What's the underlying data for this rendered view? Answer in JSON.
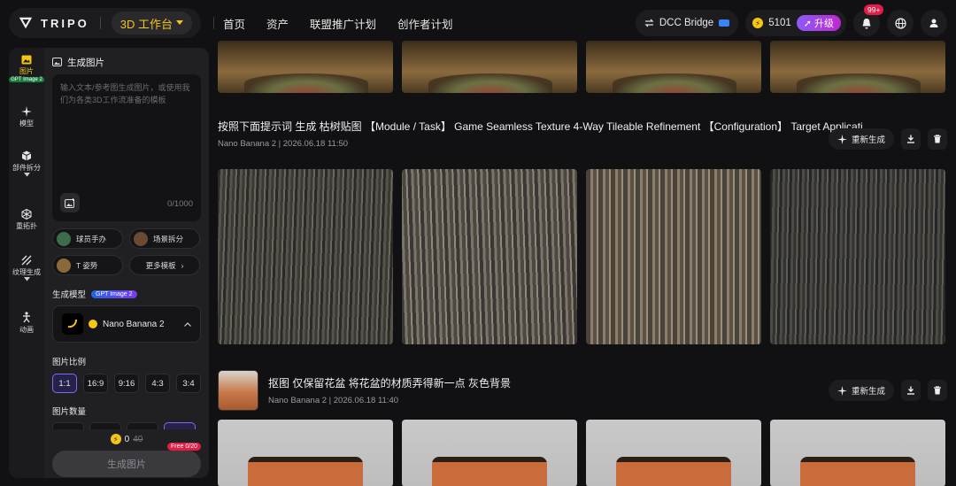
{
  "brand": {
    "name": "TRIPO",
    "workspace_label": "3D 工作台"
  },
  "nav": [
    "首页",
    "资产",
    "联盟推广计划",
    "创作者计划"
  ],
  "topright": {
    "dcc_label": "DCC Bridge",
    "credits": "5101",
    "upgrade_label": "升级",
    "notif_count": "99+"
  },
  "rail": [
    {
      "label": "图片",
      "tag": "GPT Image 2",
      "icon": "image-icon"
    },
    {
      "label": "模型",
      "icon": "sparkle-icon"
    },
    {
      "label": "部件拆分",
      "icon": "cube-icon"
    },
    {
      "label": "重拓扑",
      "icon": "topology-icon"
    },
    {
      "label": "纹理生成",
      "icon": "texture-icon"
    },
    {
      "label": "动画",
      "icon": "figure-icon"
    }
  ],
  "panel": {
    "title": "生成图片",
    "prompt_placeholder": "输入文本/参考图生成图片，或使用我们为各类3D工作流准备的模板",
    "prompt_count": "0/1000",
    "templates": [
      "球员手办",
      "场景拆分",
      "T 姿势"
    ],
    "more_templates": "更多模板",
    "model_label": "生成模型",
    "model_tag": "GPT Image 2",
    "model_name": "Nano Banana 2",
    "ratio_label": "图片比例",
    "ratios": [
      "1:1",
      "16:9",
      "9:16",
      "4:3",
      "3:4"
    ],
    "qty_label": "图片数量",
    "cost": "0",
    "cost_old": "40",
    "free_tag": "Free 0/20",
    "generate_label": "生成图片"
  },
  "generations": [
    {
      "title": "按照下面提示词 生成 枯树贴图 【Module / Task】 Game Seamless Texture 4-Way Tileable Refinement 【Configuration】 Target Applicati...",
      "meta": "Nano Banana 2 | 2026.06.18 11:50",
      "regen_label": "重新生成"
    },
    {
      "title": "抠图 仅保留花盆 将花盆的材质弄得新一点 灰色背景",
      "meta": "Nano Banana 2 | 2026.06.18 11:40",
      "regen_label": "重新生成"
    }
  ],
  "colors": {
    "accent": "#f5c518",
    "upgrade": "#8b5cf6",
    "badge": "#e11d48"
  }
}
